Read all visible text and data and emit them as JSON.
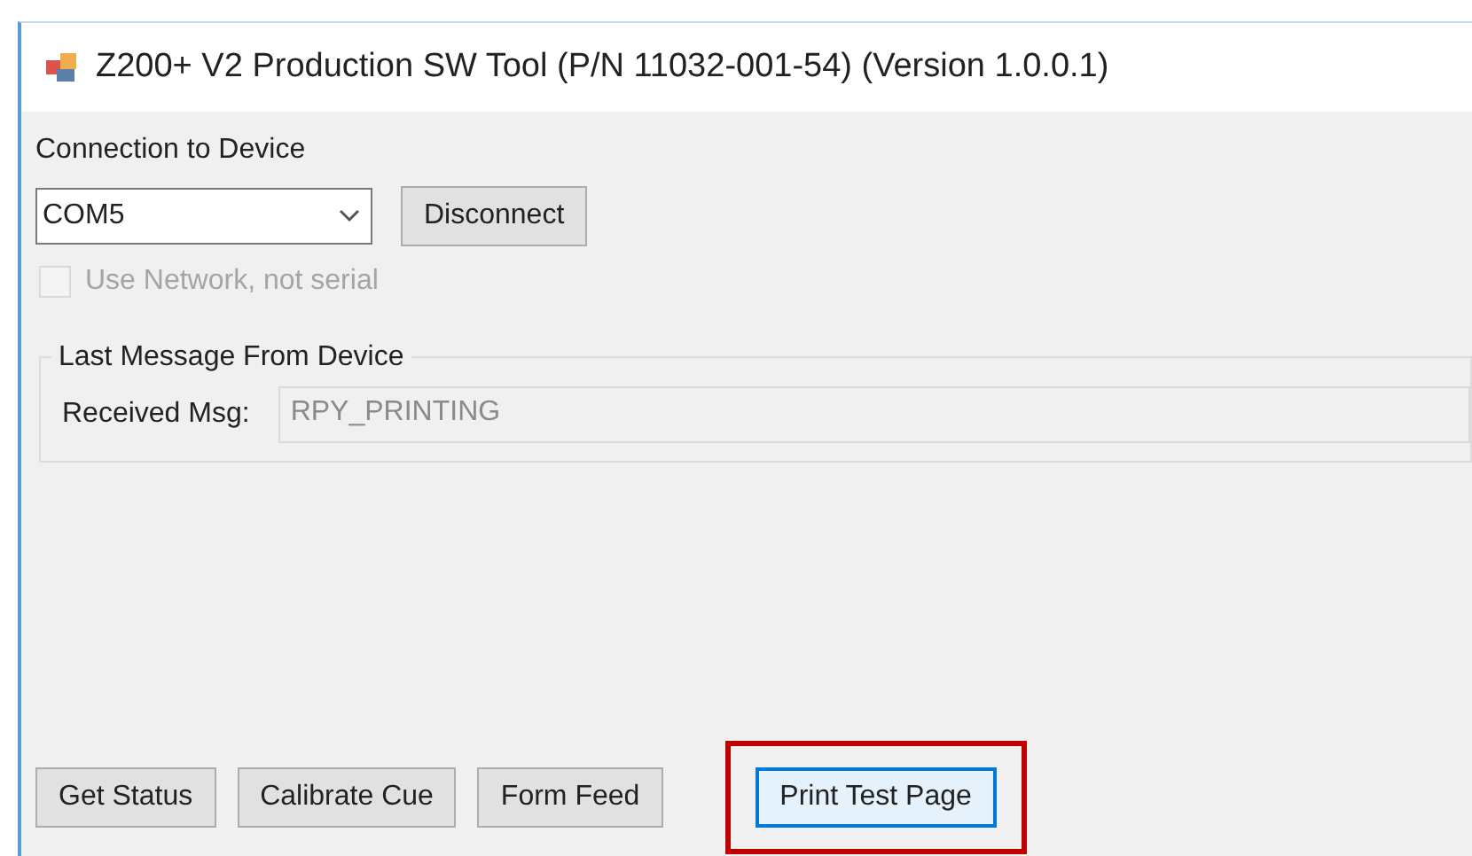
{
  "window": {
    "title": "Z200+ V2 Production SW Tool (P/N 11032-001-54) (Version 1.0.0.1)"
  },
  "connection": {
    "label": "Connection to Device",
    "port": "COM5",
    "button": "Disconnect"
  },
  "network_checkbox": {
    "label": "Use Network, not serial",
    "checked": false,
    "disabled": true
  },
  "message_group": {
    "title": "Last Message From Device",
    "field_label": "Received Msg:",
    "value": "RPY_PRINTING"
  },
  "buttons": [
    {
      "label": "Get Status",
      "highlighted": false
    },
    {
      "label": "Calibrate Cue",
      "highlighted": false
    },
    {
      "label": "Form Feed",
      "highlighted": false
    },
    {
      "label": "Print Test Page",
      "highlighted": true
    }
  ]
}
